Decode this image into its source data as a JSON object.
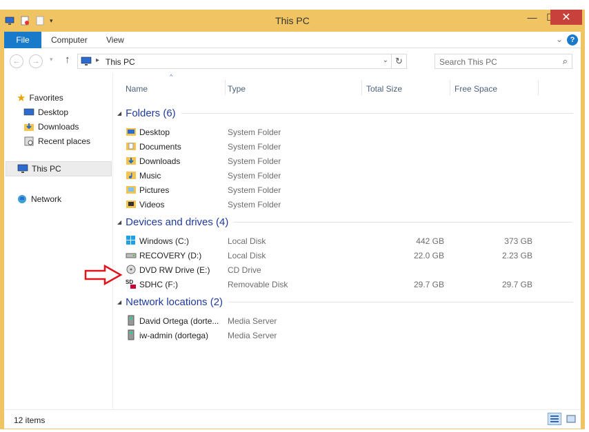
{
  "window": {
    "title": "This PC"
  },
  "controls": {
    "minimize": "—",
    "maximize": "☐",
    "close": "✕"
  },
  "ribbon": {
    "tabs": [
      "File",
      "Computer",
      "View"
    ]
  },
  "address": {
    "path": "This PC"
  },
  "search": {
    "placeholder": "Search This PC"
  },
  "sidebar": {
    "favorites": "Favorites",
    "fav_items": [
      "Desktop",
      "Downloads",
      "Recent places"
    ],
    "this_pc": "This PC",
    "network": "Network"
  },
  "columns": {
    "name": "Name",
    "type": "Type",
    "total": "Total Size",
    "free": "Free Space"
  },
  "groups": {
    "folders": "Folders (6)",
    "drives": "Devices and drives (4)",
    "network": "Network locations (2)"
  },
  "folders": [
    {
      "name": "Desktop",
      "type": "System Folder"
    },
    {
      "name": "Documents",
      "type": "System Folder"
    },
    {
      "name": "Downloads",
      "type": "System Folder"
    },
    {
      "name": "Music",
      "type": "System Folder"
    },
    {
      "name": "Pictures",
      "type": "System Folder"
    },
    {
      "name": "Videos",
      "type": "System Folder"
    }
  ],
  "drives": [
    {
      "name": "Windows (C:)",
      "type": "Local Disk",
      "total": "442 GB",
      "free": "373 GB"
    },
    {
      "name": "RECOVERY (D:)",
      "type": "Local Disk",
      "total": "22.0 GB",
      "free": "2.23 GB"
    },
    {
      "name": "DVD RW Drive (E:)",
      "type": "CD Drive",
      "total": "",
      "free": ""
    },
    {
      "name": "SDHC (F:)",
      "type": "Removable Disk",
      "total": "29.7 GB",
      "free": "29.7 GB"
    }
  ],
  "netlocs": [
    {
      "name": "David Ortega (dorte...",
      "type": "Media Server"
    },
    {
      "name": "iw-admin (dortega)",
      "type": "Media Server"
    }
  ],
  "status": {
    "count": "12 items"
  },
  "icons": [
    "pc-icon",
    "star-icon",
    "folder-icon",
    "network-icon",
    "disk-icon",
    "dvd-icon",
    "sd-icon",
    "media-server-icon",
    "search-icon"
  ],
  "colors": {
    "accent": "#1979ca",
    "frame": "#f0c462",
    "close": "#c7423a",
    "group": "#1e3aa0",
    "annotation_arrow": "#e0151b"
  }
}
